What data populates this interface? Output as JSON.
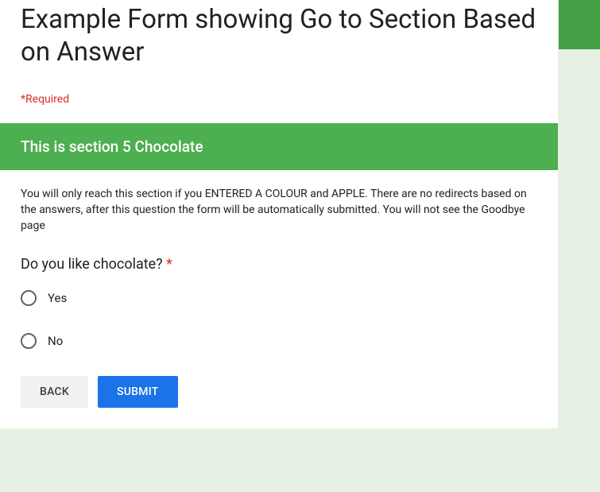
{
  "form": {
    "title": "Example Form showing Go to Section Based on Answer",
    "required_note": "*Required"
  },
  "section": {
    "title": "This is section 5 Chocolate",
    "description": "You will only reach this section if you ENTERED A COLOUR and  APPLE.  There are no redirects based on the answers, after this question the form will be automatically submitted.  You will not see the Goodbye page"
  },
  "question": {
    "text": "Do you like chocolate? ",
    "required_marker": "*",
    "options": [
      {
        "label": "Yes"
      },
      {
        "label": "No"
      }
    ]
  },
  "buttons": {
    "back": "BACK",
    "submit": "SUBMIT"
  }
}
